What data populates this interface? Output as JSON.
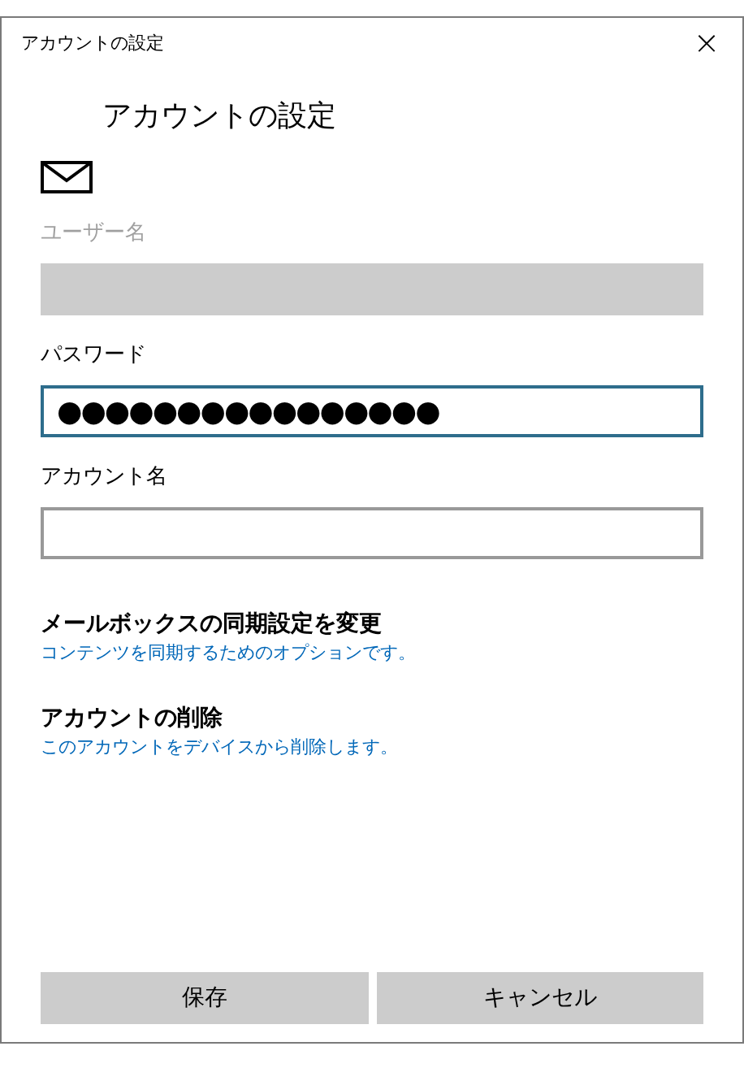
{
  "window": {
    "title": "アカウントの設定",
    "close": "×"
  },
  "heading": "アカウントの設定",
  "fields": [
    {
      "label": "ユーザー名",
      "disabled": true,
      "focused": false
    },
    {
      "label": "パスワード",
      "value": "●●●●●●●●●●●●●●●●",
      "disabled": false,
      "focused": true
    },
    {
      "label": "アカウント名",
      "disabled": false,
      "focused": false
    }
  ],
  "links": [
    {
      "title": "メールボックスの同期設定を変更",
      "description": "コンテンツを同期するためのオプションです。"
    },
    {
      "title": "アカウントの削除",
      "description": "このアカウントをデバイスから削除します。"
    }
  ],
  "buttons": [
    "保存",
    "キャンセル"
  ]
}
